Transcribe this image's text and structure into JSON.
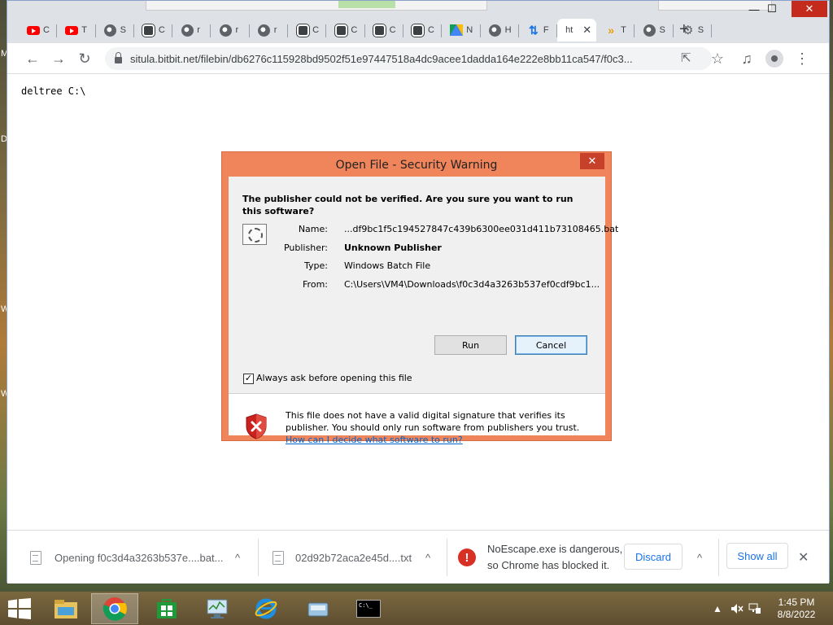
{
  "desktop": {
    "fragments": [
      "M",
      "D",
      "W",
      "W"
    ]
  },
  "browser": {
    "tabs": [
      {
        "favicon": "youtube-icon",
        "title": "C"
      },
      {
        "favicon": "youtube-icon",
        "title": "T"
      },
      {
        "favicon": "globe-icon",
        "title": "S"
      },
      {
        "favicon": "github-icon",
        "title": "C"
      },
      {
        "favicon": "globe-icon",
        "title": "r"
      },
      {
        "favicon": "globe-icon",
        "title": "r"
      },
      {
        "favicon": "globe-icon",
        "title": "r"
      },
      {
        "favicon": "github-icon",
        "title": "C"
      },
      {
        "favicon": "github-icon",
        "title": "C"
      },
      {
        "favicon": "github-icon",
        "title": "C"
      },
      {
        "favicon": "github-icon",
        "title": "C"
      },
      {
        "favicon": "drive-icon",
        "title": "N"
      },
      {
        "favicon": "globe-icon",
        "title": "H"
      },
      {
        "favicon": "transfer-arrows-icon",
        "title": "F"
      },
      {
        "favicon": "none",
        "title": "ht",
        "active": true
      },
      {
        "favicon": "double-chevron-icon",
        "title": "T"
      },
      {
        "favicon": "globe-icon",
        "title": "S"
      },
      {
        "favicon": "gear-icon",
        "title": "S"
      }
    ],
    "new_tab_label": "+",
    "window_controls": {
      "minimize": "—",
      "maximize": "☐",
      "close": "✕"
    },
    "toolbar": {
      "back": "←",
      "forward": "→",
      "reload": "↻",
      "url": "situla.bitbit.net/filebin/db6276c115928bd9502f51e97447518a4dc9acee1dadda164e222e8bb11ca547/f0c3...",
      "share": "⇱",
      "bookmark": "☆",
      "media": "♫",
      "menu": "⋮"
    },
    "page_text": "deltree C:\\"
  },
  "dialog": {
    "title": "Open File - Security Warning",
    "close": "✕",
    "question": "The publisher could not be verified.  Are you sure you want to run this software?",
    "fields": [
      {
        "label": "Name:",
        "value": "...df9bc1f5c194527847c439b6300ee031d411b73108465.bat",
        "bold": false
      },
      {
        "label": "Publisher:",
        "value": "Unknown Publisher",
        "bold": true
      },
      {
        "label": "Type:",
        "value": "Windows Batch File",
        "bold": false
      },
      {
        "label": "From:",
        "value": "C:\\Users\\VM4\\Downloads\\f0c3d4a3263b537ef0cdf9bc1...",
        "bold": false
      }
    ],
    "run_label": "Run",
    "cancel_label": "Cancel",
    "checkbox_label": "Always ask before opening this file",
    "checkbox_checked": true,
    "warning_text": "This file does not have a valid digital signature that verifies its publisher.  You should only run software from publishers you trust.",
    "warning_link": "How can I decide what software to run?"
  },
  "downloads": {
    "item1": "Opening f0c3d4a3263b537e....bat...",
    "item2": "02d92b72aca2e45d....txt",
    "danger_line1": "NoEscape.exe is dangerous,",
    "danger_line2": "so Chrome has blocked it.",
    "discard_label": "Discard",
    "show_all_label": "Show all",
    "chevron": "^",
    "close": "✕"
  },
  "taskbar": {
    "apps": [
      {
        "name": "file-explorer-icon",
        "active": false
      },
      {
        "name": "chrome-icon",
        "active": true
      },
      {
        "name": "store-icon",
        "active": false
      },
      {
        "name": "task-manager-icon",
        "active": false
      },
      {
        "name": "internet-explorer-icon",
        "active": false
      },
      {
        "name": "drive-app-icon",
        "active": false
      },
      {
        "name": "cmd-icon",
        "active": false
      }
    ],
    "cmd_text": "C:\\_",
    "tray_up": "▲",
    "time": "1:45 PM",
    "date": "8/8/2022"
  }
}
